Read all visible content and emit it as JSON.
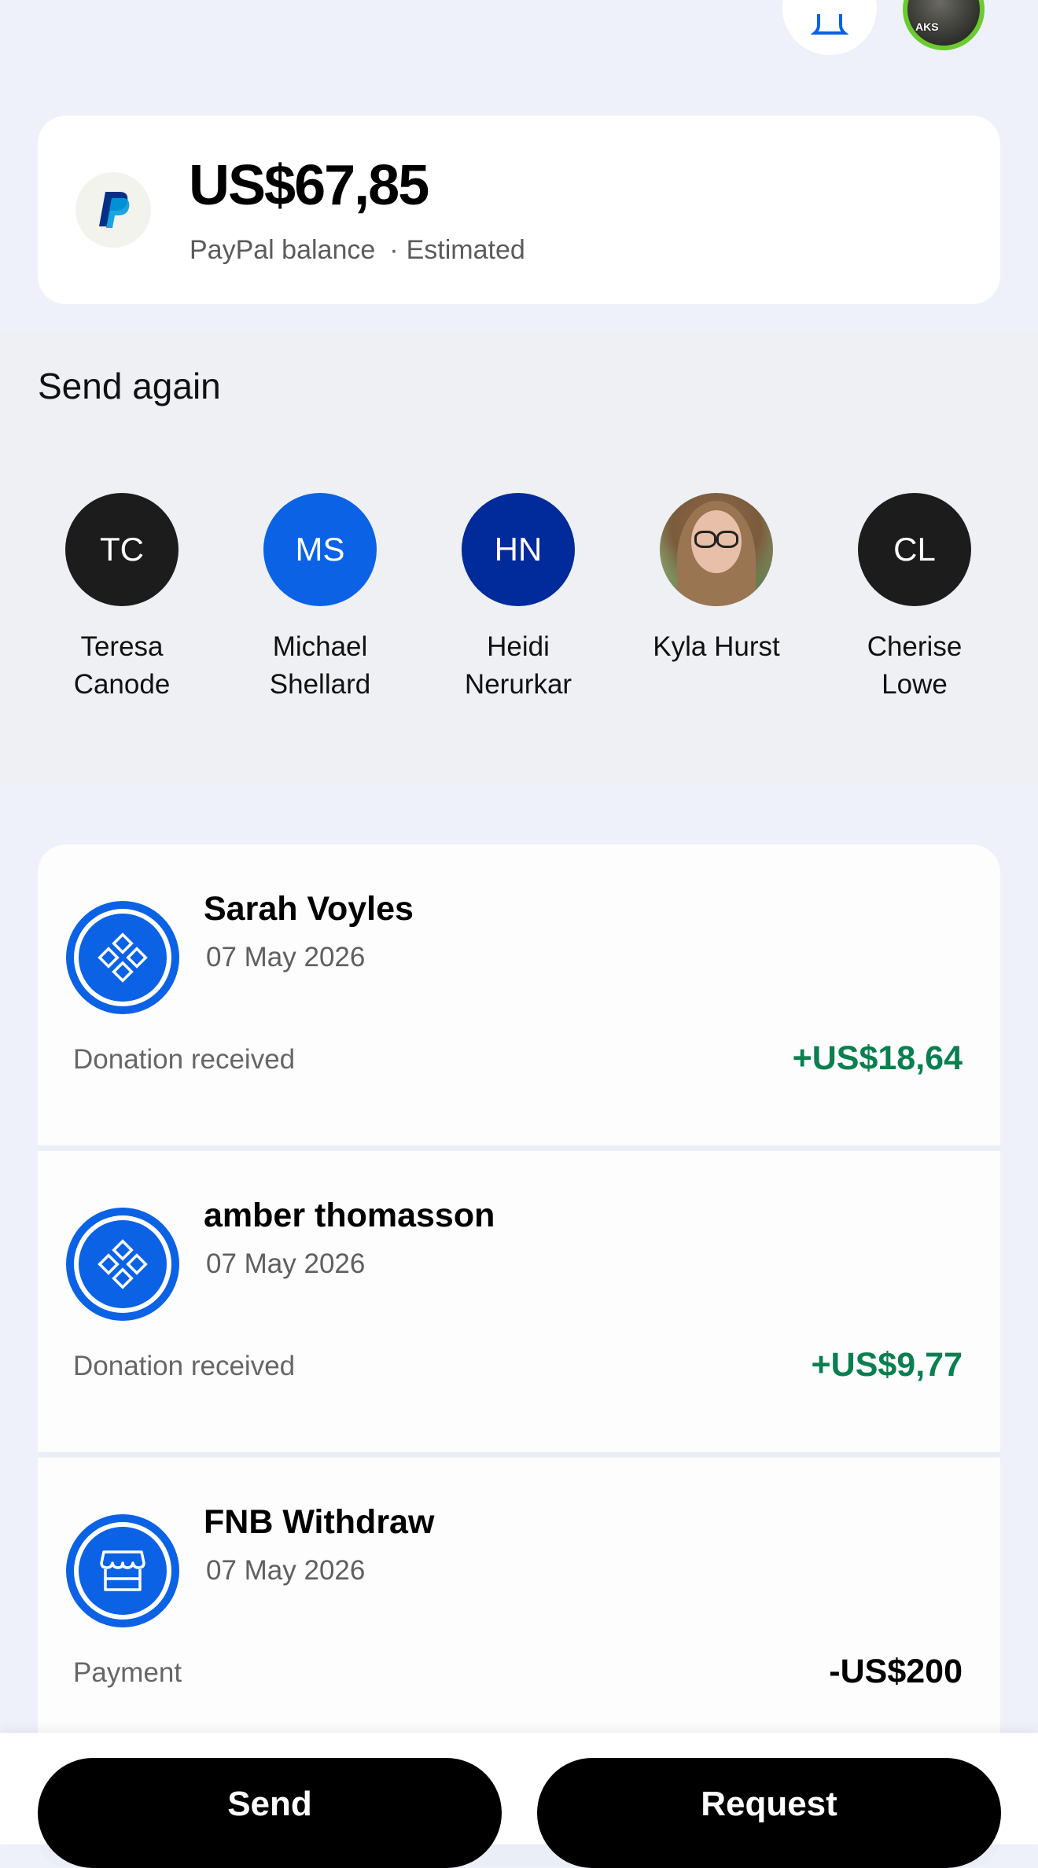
{
  "balance": {
    "amount": "US$67,85",
    "label": "PayPal balance",
    "estimated": "Estimated",
    "dot": "·"
  },
  "send_again": {
    "title": "Send again",
    "contacts": [
      {
        "initials": "TC",
        "name_line1": "Teresa",
        "name_line2": "Canode",
        "color": "#1c1c1c"
      },
      {
        "initials": "MS",
        "name_line1": "Michael",
        "name_line2": "Shellard",
        "color": "#0b62e5"
      },
      {
        "initials": "HN",
        "name_line1": "Heidi",
        "name_line2": "Nerurkar",
        "color": "#012a9b"
      },
      {
        "initials": "",
        "name_line1": "Kyla Hurst",
        "name_line2": "",
        "color": "photo"
      },
      {
        "initials": "CL",
        "name_line1": "Cherise",
        "name_line2": "Lowe",
        "color": "#1c1c1c"
      }
    ]
  },
  "transactions": [
    {
      "name": "Sarah Voyles",
      "date": "07 May 2026",
      "type": "Donation received",
      "amount": "+US$18,64",
      "icon": "donation-icon"
    },
    {
      "name": "amber thomasson",
      "date": "07 May 2026",
      "type": "Donation received",
      "amount": "+US$9,77",
      "icon": "donation-icon"
    },
    {
      "name": "FNB Withdraw",
      "date": "07 May 2026",
      "type": "Payment",
      "amount": "-US$200",
      "icon": "store-icon"
    }
  ],
  "actions": {
    "send": "Send",
    "request": "Request"
  },
  "colors": {
    "accent": "#0b62e5",
    "positive": "#0a7f4f"
  },
  "avatar_tag": "AKS"
}
